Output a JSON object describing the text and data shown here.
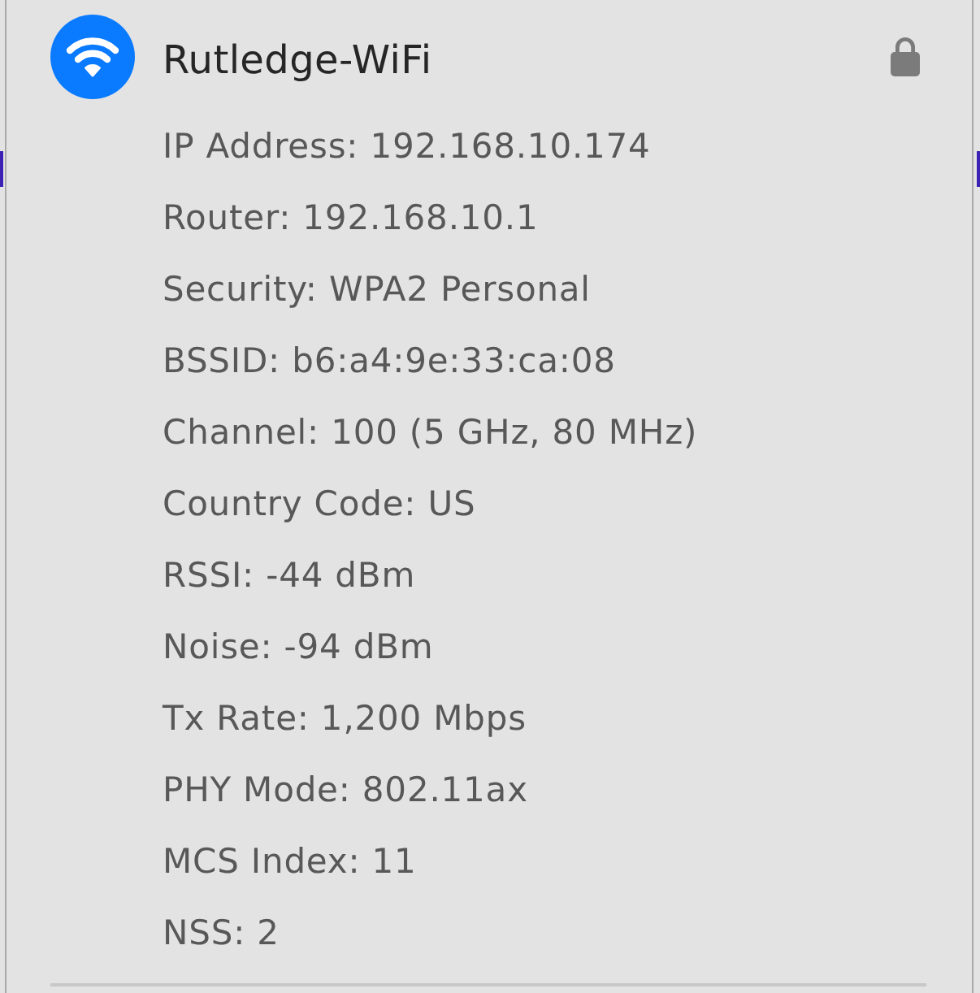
{
  "network": {
    "name": "Rutledge-WiFi",
    "connected": true,
    "secured": true
  },
  "details": [
    "IP Address: 192.168.10.174",
    "Router: 192.168.10.1",
    "Security: WPA2 Personal",
    "BSSID: b6:a4:9e:33:ca:08",
    "Channel: 100 (5 GHz, 80 MHz)",
    "Country Code: US",
    "RSSI: -44 dBm",
    "Noise: -94 dBm",
    "Tx Rate: 1,200 Mbps",
    "PHY Mode: 802.11ax",
    "MCS Index: 11",
    "NSS: 2"
  ]
}
